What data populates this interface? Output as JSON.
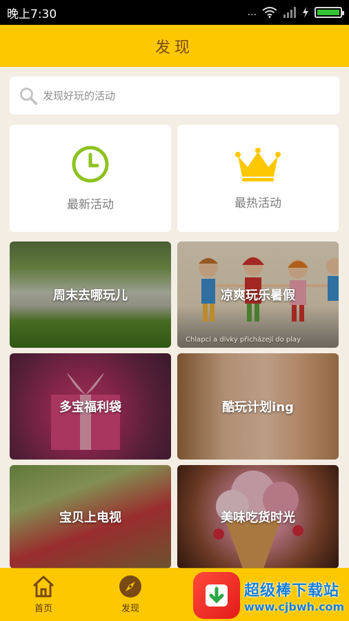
{
  "status_bar": {
    "time": "晚上7:30",
    "dots": "...",
    "wifi_icon": "wifi-icon",
    "signal_icon": "signal-icon",
    "charging_icon": "bolt-icon",
    "battery_icon": "battery-icon"
  },
  "header": {
    "title": "发现"
  },
  "search": {
    "placeholder": "发现好玩的活动",
    "icon": "search-icon"
  },
  "quick_cards": [
    {
      "label": "最新活动",
      "icon": "clock-icon",
      "color": "#8dc21f"
    },
    {
      "label": "最热活动",
      "icon": "crown-icon",
      "color": "#fdc800"
    }
  ],
  "tiles": [
    {
      "label": "周末去哪玩儿",
      "caption": ""
    },
    {
      "label": "凉爽玩乐暑假",
      "caption": "Chlapci a dívky přicházejí do play"
    },
    {
      "label": "多宝福利袋",
      "caption": ""
    },
    {
      "label": "酷玩计划ing",
      "caption": ""
    },
    {
      "label": "宝贝上电视",
      "caption": ""
    },
    {
      "label": "美味吃货时光",
      "caption": ""
    }
  ],
  "bottom_nav": [
    {
      "label": "首页",
      "icon": "home-icon"
    },
    {
      "label": "发现",
      "icon": "compass-icon"
    }
  ],
  "watermark": {
    "name": "超级棒下载站",
    "url": "www.cjbwh.com"
  },
  "colors": {
    "accent": "#fdc800",
    "background": "#f3ede4"
  }
}
